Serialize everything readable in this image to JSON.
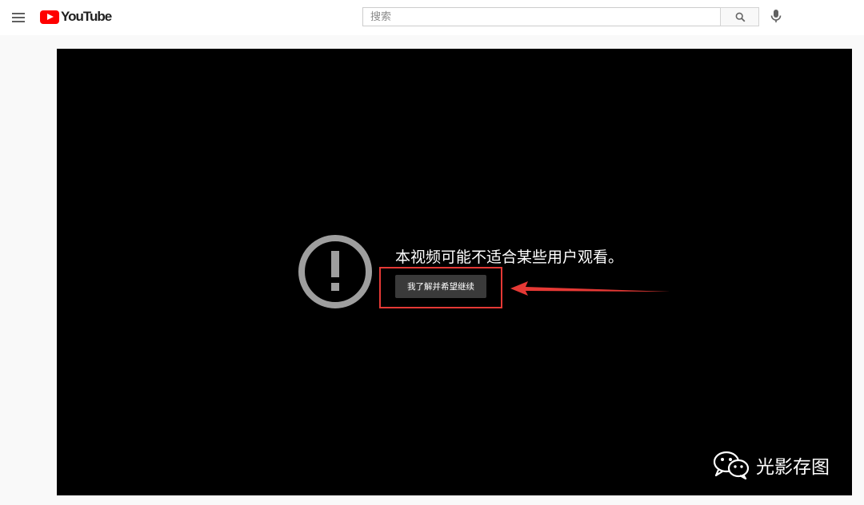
{
  "header": {
    "logo_text": "YouTube",
    "search_placeholder": "搜索"
  },
  "player": {
    "warning_message": "本视频可能不适合某些用户观看。",
    "continue_button_label": "我了解并希望继续"
  },
  "watermark": {
    "text": "光影存图"
  },
  "colors": {
    "brand_red": "#ff0000",
    "annotation_red": "#e53935",
    "player_bg": "#000000"
  }
}
